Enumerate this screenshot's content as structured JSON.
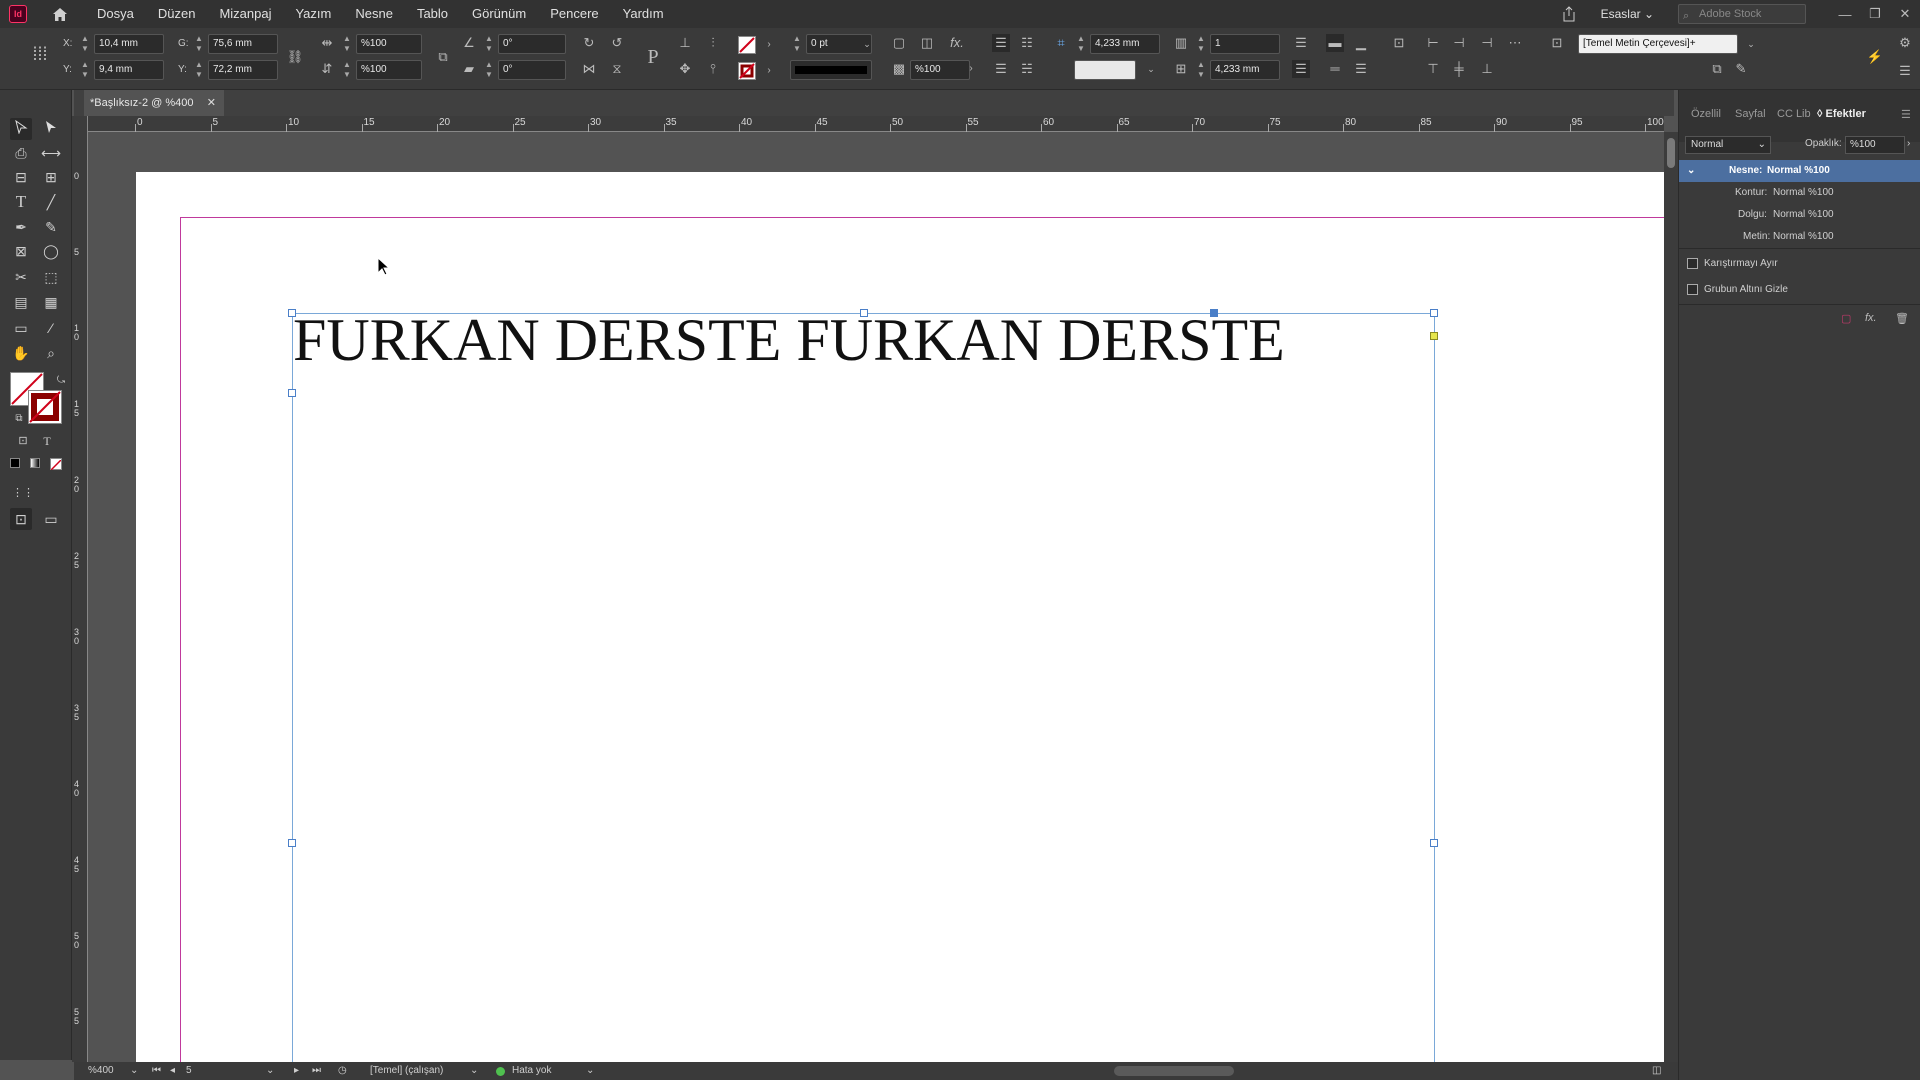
{
  "app": {
    "logo_text": "Id"
  },
  "menu": [
    "Dosya",
    "Düzen",
    "Mizanpaj",
    "Yazım",
    "Nesne",
    "Tablo",
    "Görünüm",
    "Pencere",
    "Yardım"
  ],
  "header": {
    "workspace": "Esaslar",
    "search_placeholder": "Adobe Stock"
  },
  "control": {
    "x_label": "X:",
    "x_value": "10,4 mm",
    "y_label": "Y:",
    "y_value": "9,4 mm",
    "w_label": "G:",
    "w_value": "75,6 mm",
    "h_label": "Y:",
    "h_value": "72,2 mm",
    "scale_x": "%100",
    "scale_y": "%100",
    "angle": "0°",
    "shear": "0°",
    "stroke_weight": "0 pt",
    "opacity": "%100",
    "inset_top": "4,233 mm",
    "inset_bottom": "4,233 mm",
    "columns": "1",
    "frame_style": "[Temel Metin Çerçevesi]+"
  },
  "document": {
    "tab_title": "*Başlıksız-2 @ %400",
    "frame_text": "FURKAN DERSTE FURKAN DERSTE"
  },
  "ruler_h": [
    "0",
    "5",
    "10",
    "15",
    "20",
    "25",
    "30",
    "35",
    "40",
    "45",
    "50",
    "55",
    "60",
    "65",
    "70",
    "75",
    "80",
    "85",
    "90",
    "95",
    "100"
  ],
  "ruler_v": [
    "0",
    "5",
    "10",
    "15",
    "20",
    "25",
    "30",
    "35",
    "40",
    "45",
    "50",
    "55"
  ],
  "panel": {
    "tabs": [
      "Özellil",
      "Sayfal",
      "CC Lib",
      "Efektler"
    ],
    "blend_mode": "Normal",
    "opacity_label": "Opaklık:",
    "opacity_value": "%100",
    "rows": [
      {
        "label": "Nesne:",
        "value": "Normal %100"
      },
      {
        "label": "Kontur:",
        "value": "Normal %100"
      },
      {
        "label": "Dolgu:",
        "value": "Normal %100"
      },
      {
        "label": "Metin:",
        "value": "Normal %100"
      }
    ],
    "checkbox_1": "Karıştırmayı Ayır",
    "checkbox_2": "Grubun Altını Gizle"
  },
  "status": {
    "zoom": "%400",
    "page": "5",
    "profile": "[Temel] (çalışan)",
    "preflight": "Hata yok"
  },
  "colors": {
    "accent": "#4c6fa0",
    "margin": "#c0399c",
    "frame": "#7aa8d8",
    "ok": "#4fc04f"
  }
}
